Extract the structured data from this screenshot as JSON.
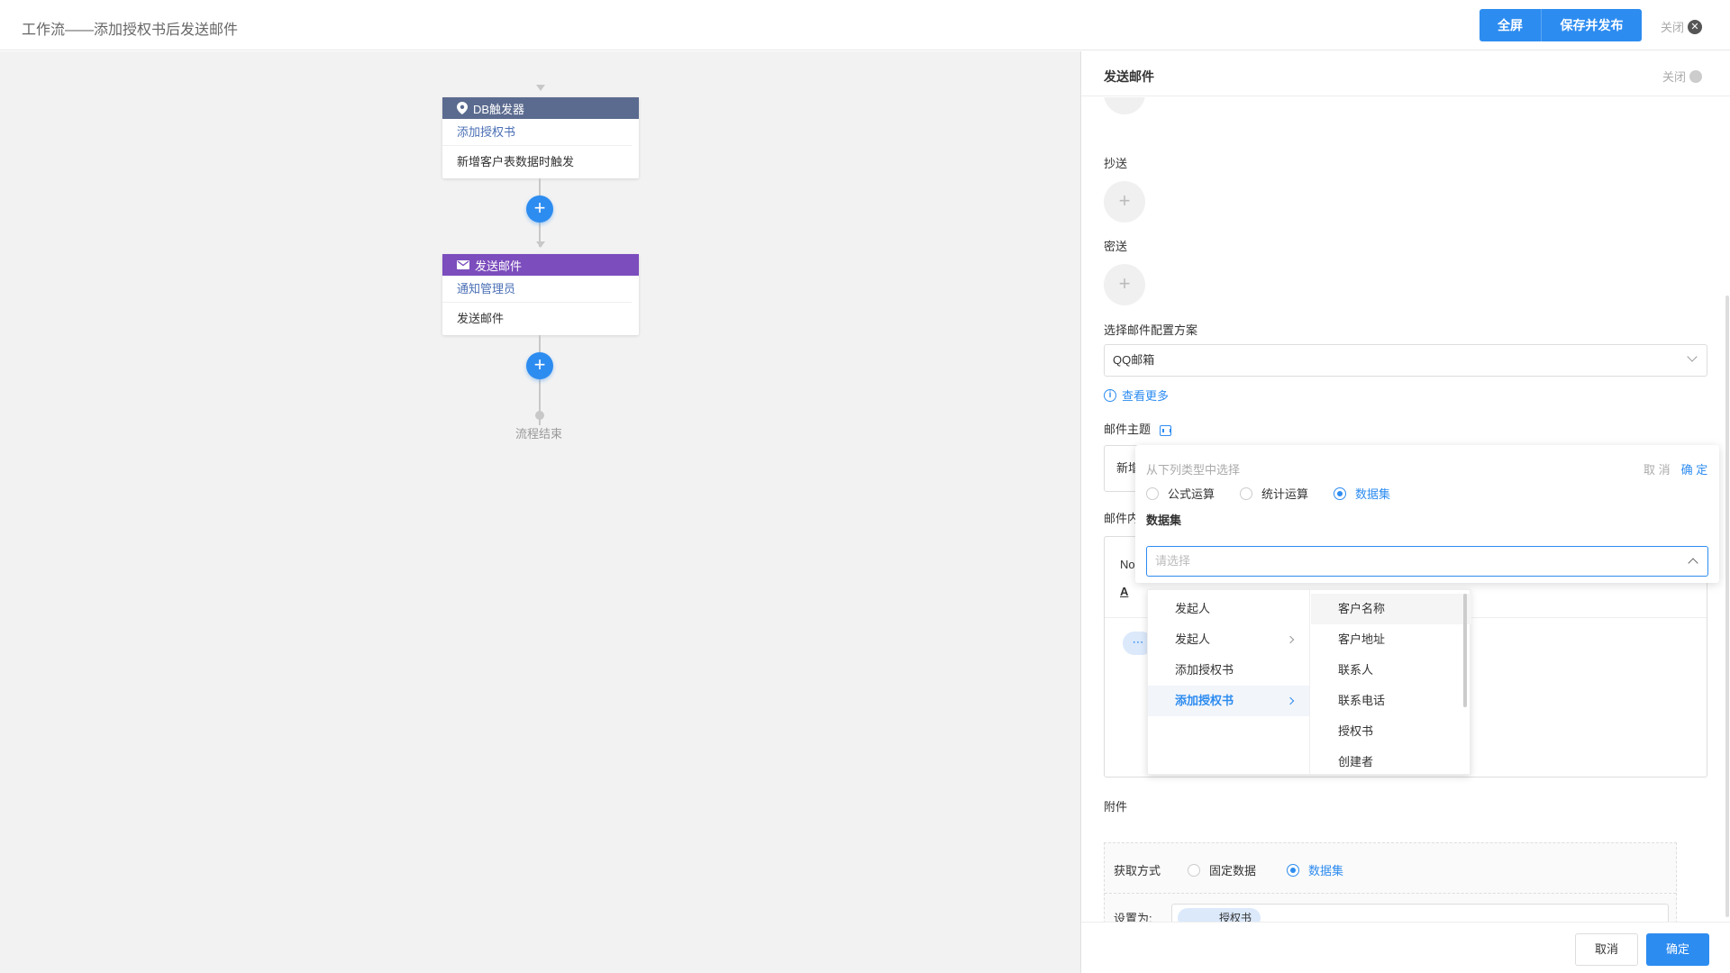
{
  "header": {
    "title": "工作流——添加授权书后发送邮件",
    "fullscreen_label": "全屏",
    "save_publish_label": "保存并发布",
    "close_label": "关闭"
  },
  "canvas": {
    "trigger_node": {
      "type_label": "DB触发器",
      "name": "添加授权书",
      "desc": "新增客户表数据时触发",
      "color": "#5b6b8f"
    },
    "mail_node": {
      "type_label": "发送邮件",
      "name": "通知管理员",
      "desc": "发送邮件",
      "color": "#7c4dbd"
    },
    "end_label": "流程结束"
  },
  "panel": {
    "title": "发送邮件",
    "close_label": "关闭",
    "cc_label": "抄送",
    "bcc_label": "密送",
    "scheme_label": "选择邮件配置方案",
    "scheme_value": "QQ邮箱",
    "more_link": "查看更多",
    "subject_label": "邮件主题",
    "subject_value_partial": "新增",
    "content_label_partial": "邮件内",
    "editor_text_partial": "No",
    "attachment_label": "附件",
    "fetch_label": "获取方式",
    "fetch_options": [
      "固定数据",
      "数据集"
    ],
    "fetch_selected": "数据集",
    "set_label": "设置为:",
    "set_tag": "授权书",
    "footer_cancel": "取消",
    "footer_ok": "确定"
  },
  "popover": {
    "hint": "从下列类型中选择",
    "cancel": "取 消",
    "ok": "确 定",
    "options": [
      "公式运算",
      "统计运算",
      "数据集"
    ],
    "selected": "数据集",
    "dataset_label": "数据集",
    "select_placeholder": "请选择"
  },
  "cascader": {
    "level1": [
      "发起人",
      "发起人",
      "添加授权书",
      "添加授权书"
    ],
    "level1_active": "添加授权书",
    "level2": [
      "客户名称",
      "客户地址",
      "联系人",
      "联系电话",
      "授权书",
      "创建者"
    ]
  }
}
